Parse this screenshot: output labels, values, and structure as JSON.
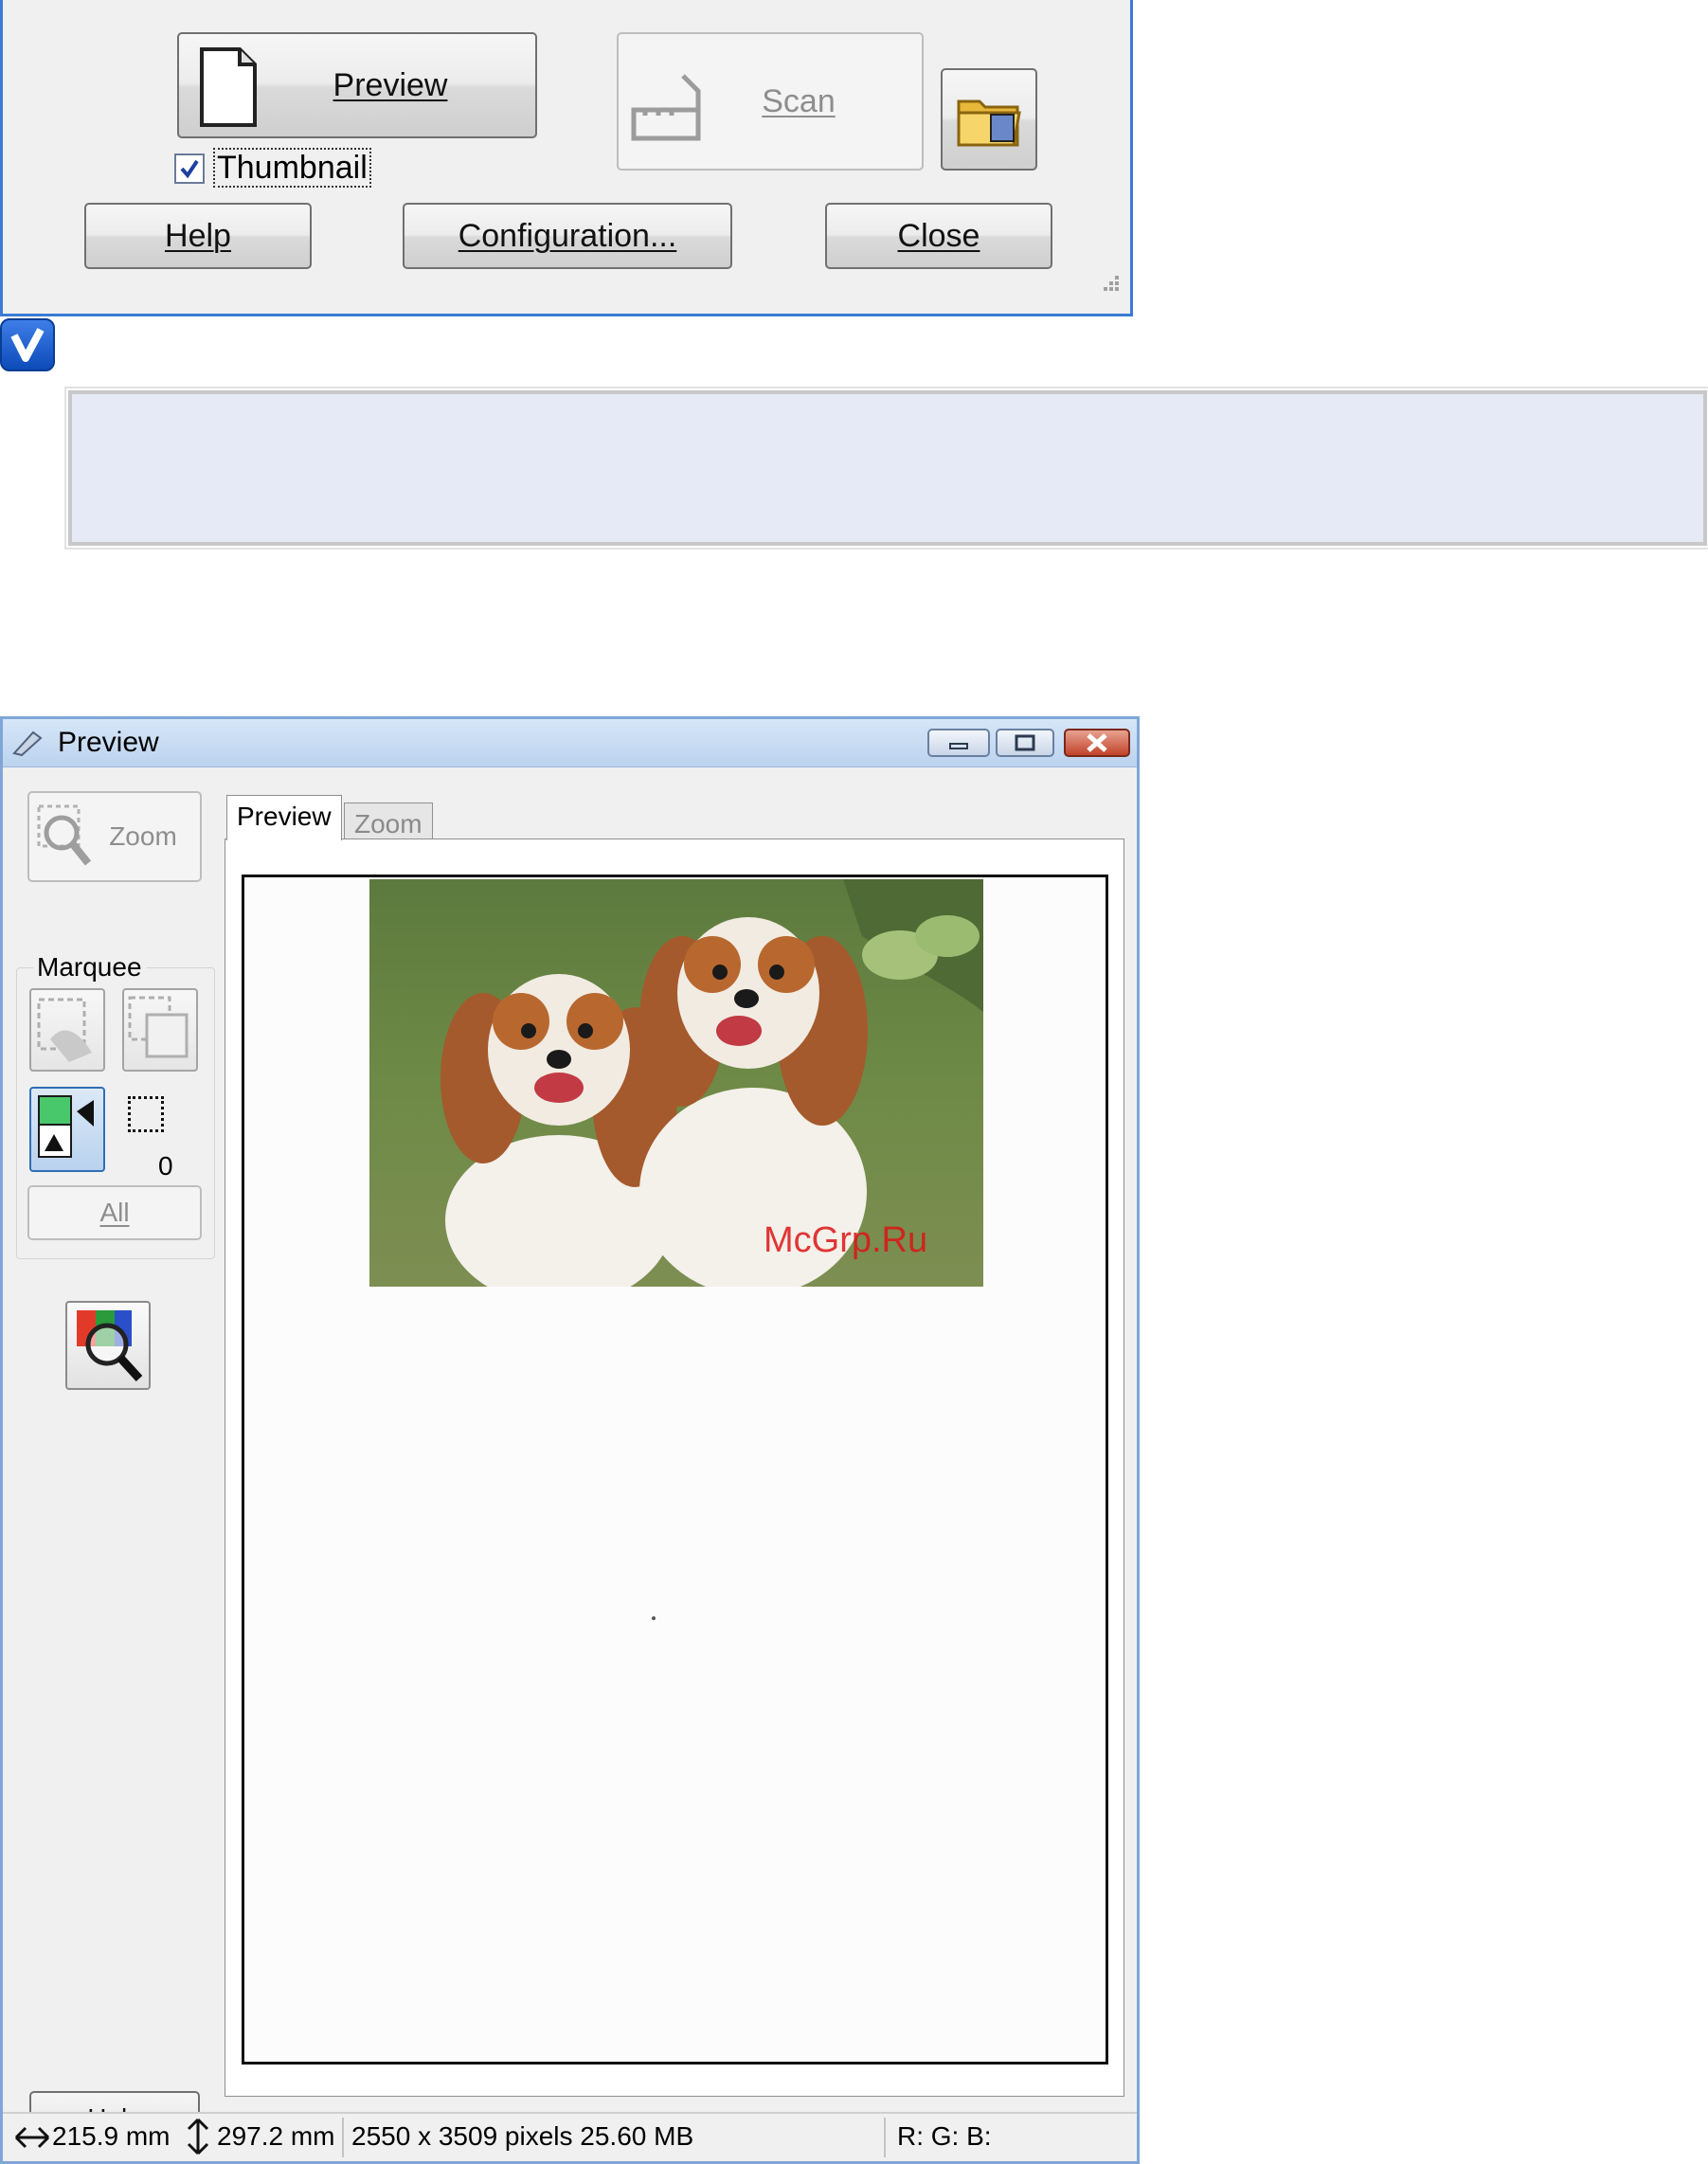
{
  "scan_dialog": {
    "preview_button": "Preview",
    "scan_button": "Scan",
    "thumbnail_label": "Thumbnail",
    "thumbnail_checked": true,
    "help_button": "Help",
    "configuration_button": "Configuration...",
    "close_button": "Close"
  },
  "note": {
    "icon": "note-check-icon",
    "text": ""
  },
  "preview_window": {
    "title": "Preview",
    "zoom_button": "Zoom",
    "marquee_label": "Marquee",
    "marquee_count": "0",
    "all_button": "All",
    "help_button": "Help",
    "tabs": [
      {
        "label": "Preview",
        "active": true
      },
      {
        "label": "Zoom",
        "active": false
      }
    ],
    "watermark": "McGrp.Ru",
    "status": {
      "width": "215.9 mm",
      "height": "297.2 mm",
      "size_info": "2550 x 3509 pixels 25.60 MB",
      "rgb": "R: G: B:"
    }
  },
  "colors": {
    "window_border": "#7fa6d6",
    "note_background": "#e6e9f6",
    "watermark": "#dc1414"
  }
}
